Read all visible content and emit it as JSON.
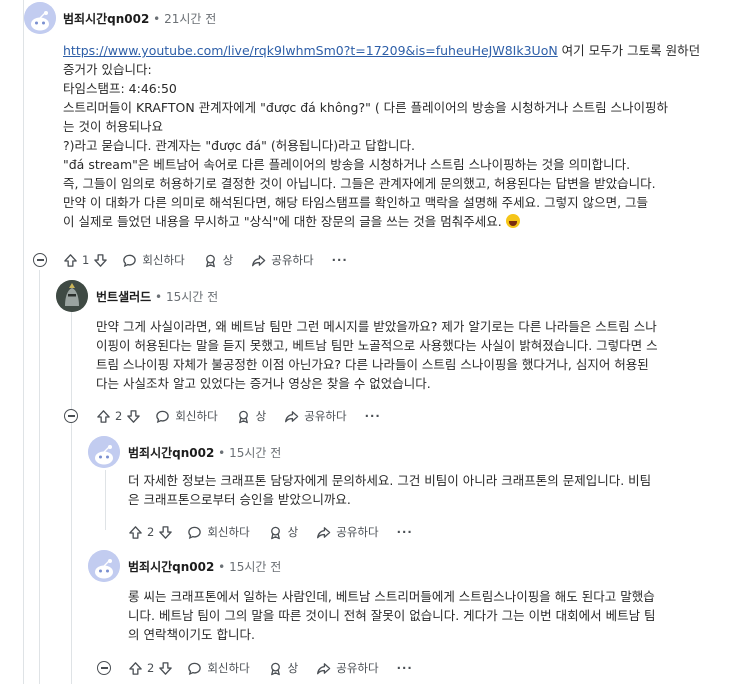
{
  "comments": [
    {
      "user": "범죄시간qn002",
      "time": "21시간 전",
      "link": "https://www.youtube.com/live/rqk9lwhmSm0?t=17209&is=fuheuHeJW8Ik3UoN",
      "lines": [
        " 여기 모두가 그토록 원하던",
        "증거가 있습니다:",
        "타임스탬프: 4:46:50",
        "스트리머들이 KRAFTON 관계자에게 \"được đá không?\" ( 다른 플레이어의 방송을 시청하거나 스트림 스나이핑하",
        "는 것이 허용되나요",
        "?)라고 묻습니다. 관계자는 \"được đá\" (허용됩니다)라고 답합니다.",
        "\"đá stream\"은 베트남어 속어로 다른 플레이어의 방송을 시청하거나 스트림 스나이핑하는 것을 의미합니다.",
        "즉, 그들이 임의로 허용하기로 결정한 것이 아닙니다. 그들은 관계자에게 문의했고, 허용된다는 답변을 받았습니다.",
        "만약 이 대화가 다른 의미로 해석된다면, 해당 타임스탬프를 확인하고 맥락을 설명해 주세요. 그렇지 않으면, 그들",
        "이 실제로 들었던 내용을 무시하고 \"상식\"에 대한 장문의 글을 쓰는 것을 멈춰주세요. "
      ],
      "votes": "1"
    },
    {
      "user": "번트샐러드",
      "time": "15시간 전",
      "lines": [
        "만약 그게 사실이라면, 왜 베트남 팀만 그런 메시지를 받았을까요? 제가 알기로는 다른 나라들은 스트림 스나",
        "이핑이 허용된다는 말을 듣지 못했고, 베트남 팀만 노골적으로 사용했다는 사실이 밝혀졌습니다. 그렇다면 스",
        "트림 스나이핑 자체가 불공정한 이점 아닌가요? 다른 나라들이 스트림 스나이핑을 했다거나, 심지어 허용된",
        "다는 사실조차 알고 있었다는 증거나 영상은 찾을 수 없었습니다."
      ],
      "votes": "2"
    },
    {
      "user": "범죄시간qn002",
      "time": "15시간 전",
      "lines": [
        "더 자세한 정보는 크래프톤 담당자에게 문의하세요. 그건 비팀이 아니라 크래프톤의 문제입니다. 비팀",
        "은 크래프톤으로부터 승인을 받았으니까요."
      ],
      "votes": "2"
    },
    {
      "user": "범죄시간qn002",
      "time": "15시간 전",
      "lines": [
        "롱 씨는 크래프톤에서 일하는 사람인데, 베트남 스트리머들에게 스트림스나이핑을 해도 된다고 말했습",
        "니다. 베트남 팀이 그의 말을 따른 것이니 전혀 잘못이 없습니다. 게다가 그는 이번 대회에서 베트남 팀",
        "의 연락책이기도 합니다."
      ],
      "votes": "2"
    }
  ],
  "actions": {
    "reply": "회신하다",
    "award": "상",
    "share": "공유하다",
    "more": "···"
  },
  "icons": {
    "upvote": "arrow-up-icon",
    "downvote": "arrow-down-icon",
    "reply": "speech-bubble-icon",
    "award": "award-icon",
    "share": "share-arrow-icon",
    "collapse": "collapse-minus-icon"
  },
  "colors": {
    "link": "#2e5fa8",
    "avatar_bg": "#c2ccf0",
    "thread_line": "#dfe3e6"
  }
}
